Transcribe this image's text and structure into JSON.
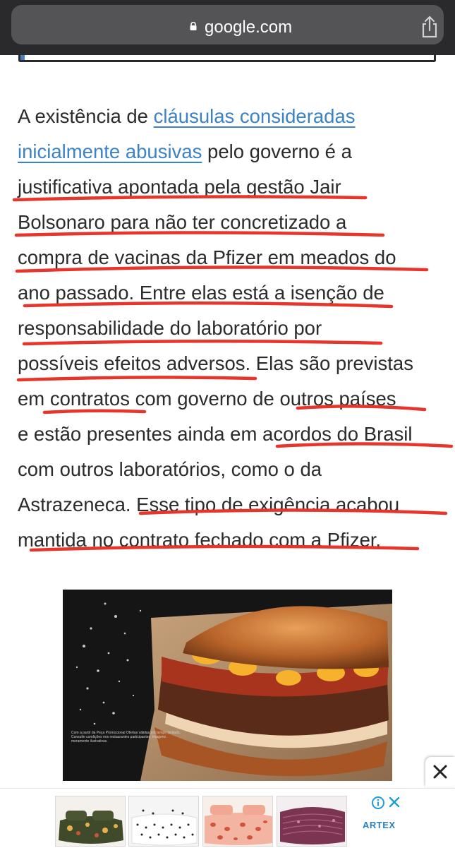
{
  "browser": {
    "url": "google.com",
    "icons": [
      "lock-icon",
      "share-icon"
    ]
  },
  "article": {
    "lines": [
      {
        "pre": "A existência de ",
        "link": "cláusulas consideradas",
        "post": ""
      },
      {
        "pre": "",
        "link": "inicialmente abusivas",
        "post": " pelo governo é a"
      },
      {
        "pre": "justificativa apontada pela gestão Jair",
        "link": "",
        "post": ""
      },
      {
        "pre": "Bolsonaro para não ter concretizado a",
        "link": "",
        "post": ""
      },
      {
        "pre": "compra de vacinas da Pfizer em meados do",
        "link": "",
        "post": ""
      },
      {
        "pre": "ano passado. Entre elas está a isenção de",
        "link": "",
        "post": ""
      },
      {
        "pre": "responsabilidade do laboratório por",
        "link": "",
        "post": ""
      },
      {
        "pre": "possíveis efeitos adversos. Elas são previstas",
        "link": "",
        "post": ""
      },
      {
        "pre": "em contratos com governo de outros países",
        "link": "",
        "post": ""
      },
      {
        "pre": "e estão presentes ainda em acordos do Brasil",
        "link": "",
        "post": ""
      },
      {
        "pre": "com outros laboratórios, como o da",
        "link": "",
        "post": ""
      },
      {
        "pre": "Astrazeneca. Esse tipo de exigência acabou",
        "link": "",
        "post": ""
      },
      {
        "pre": "mantida no contrato fechado com a Pfizer.",
        "link": "",
        "post": ""
      }
    ]
  },
  "annotation": {
    "color": "#e8352b"
  },
  "ad": {
    "image_subject": "burger-ad-image",
    "fine_print": "Com a partir da Peça Promocional Ofertas válidas por tempo limitado. Consulte condições nos restaurantes participantes. Imagens meramente ilustrativas.",
    "close_icon": "close-icon",
    "brand": "ARTEX",
    "thumbnails": [
      "floral-bedding",
      "polka-dot-bedding",
      "pink-pattern-bedding",
      "purple-quilt-bedding"
    ]
  }
}
